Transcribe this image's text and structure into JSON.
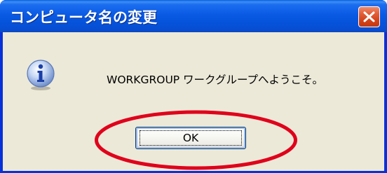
{
  "window": {
    "title": "コンピュータ名の変更",
    "close_icon": "close-icon"
  },
  "dialog": {
    "icon": "info-icon",
    "message": "WORKGROUP ワークグループへようこそ。",
    "ok_label": "OK"
  },
  "annotation": {
    "ellipse_color": "#e0001b",
    "target": "ok-button"
  },
  "colors": {
    "titlebar_blue": "#0a5ae4",
    "client_bg": "#ece9d8",
    "close_red": "#d2421a"
  }
}
